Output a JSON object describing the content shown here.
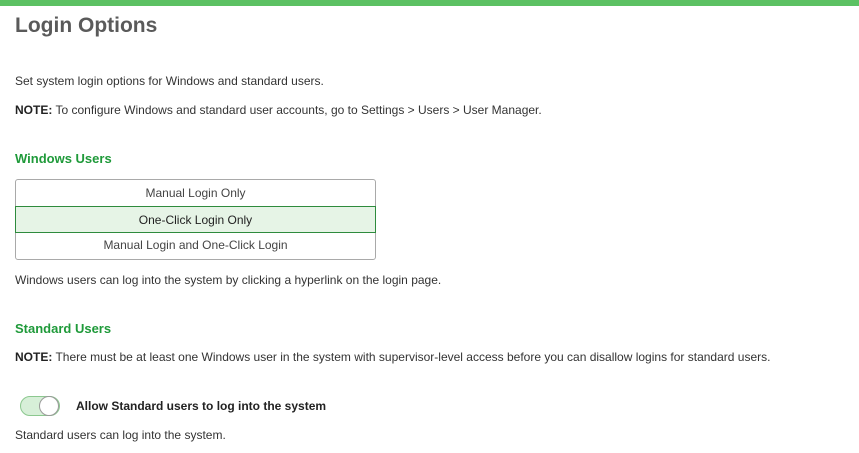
{
  "colors": {
    "accent_bar": "#5cc163",
    "section_heading": "#1f9a3a",
    "selected_option_bg": "#e6f4e6",
    "selected_option_border": "#2e8b3d"
  },
  "page": {
    "title": "Login Options",
    "intro": "Set system login options for Windows and standard users.",
    "note_label": "NOTE:",
    "note_text": " To configure Windows and standard user accounts, go to Settings > Users > User Manager."
  },
  "windows_users": {
    "heading": "Windows Users",
    "options": [
      {
        "label": "Manual Login Only",
        "selected": false
      },
      {
        "label": "One-Click Login Only",
        "selected": true
      },
      {
        "label": "Manual Login and One-Click Login",
        "selected": false
      }
    ],
    "description": "Windows users can log into the system by clicking a hyperlink on the login page."
  },
  "standard_users": {
    "heading": "Standard Users",
    "note_label": "NOTE:",
    "note_text": " There must be at least one Windows user in the system with supervisor-level access before you can disallow logins for standard users.",
    "toggle_label": "Allow Standard users to log into the system",
    "toggle_on": true,
    "description": "Standard users can log into the system."
  }
}
